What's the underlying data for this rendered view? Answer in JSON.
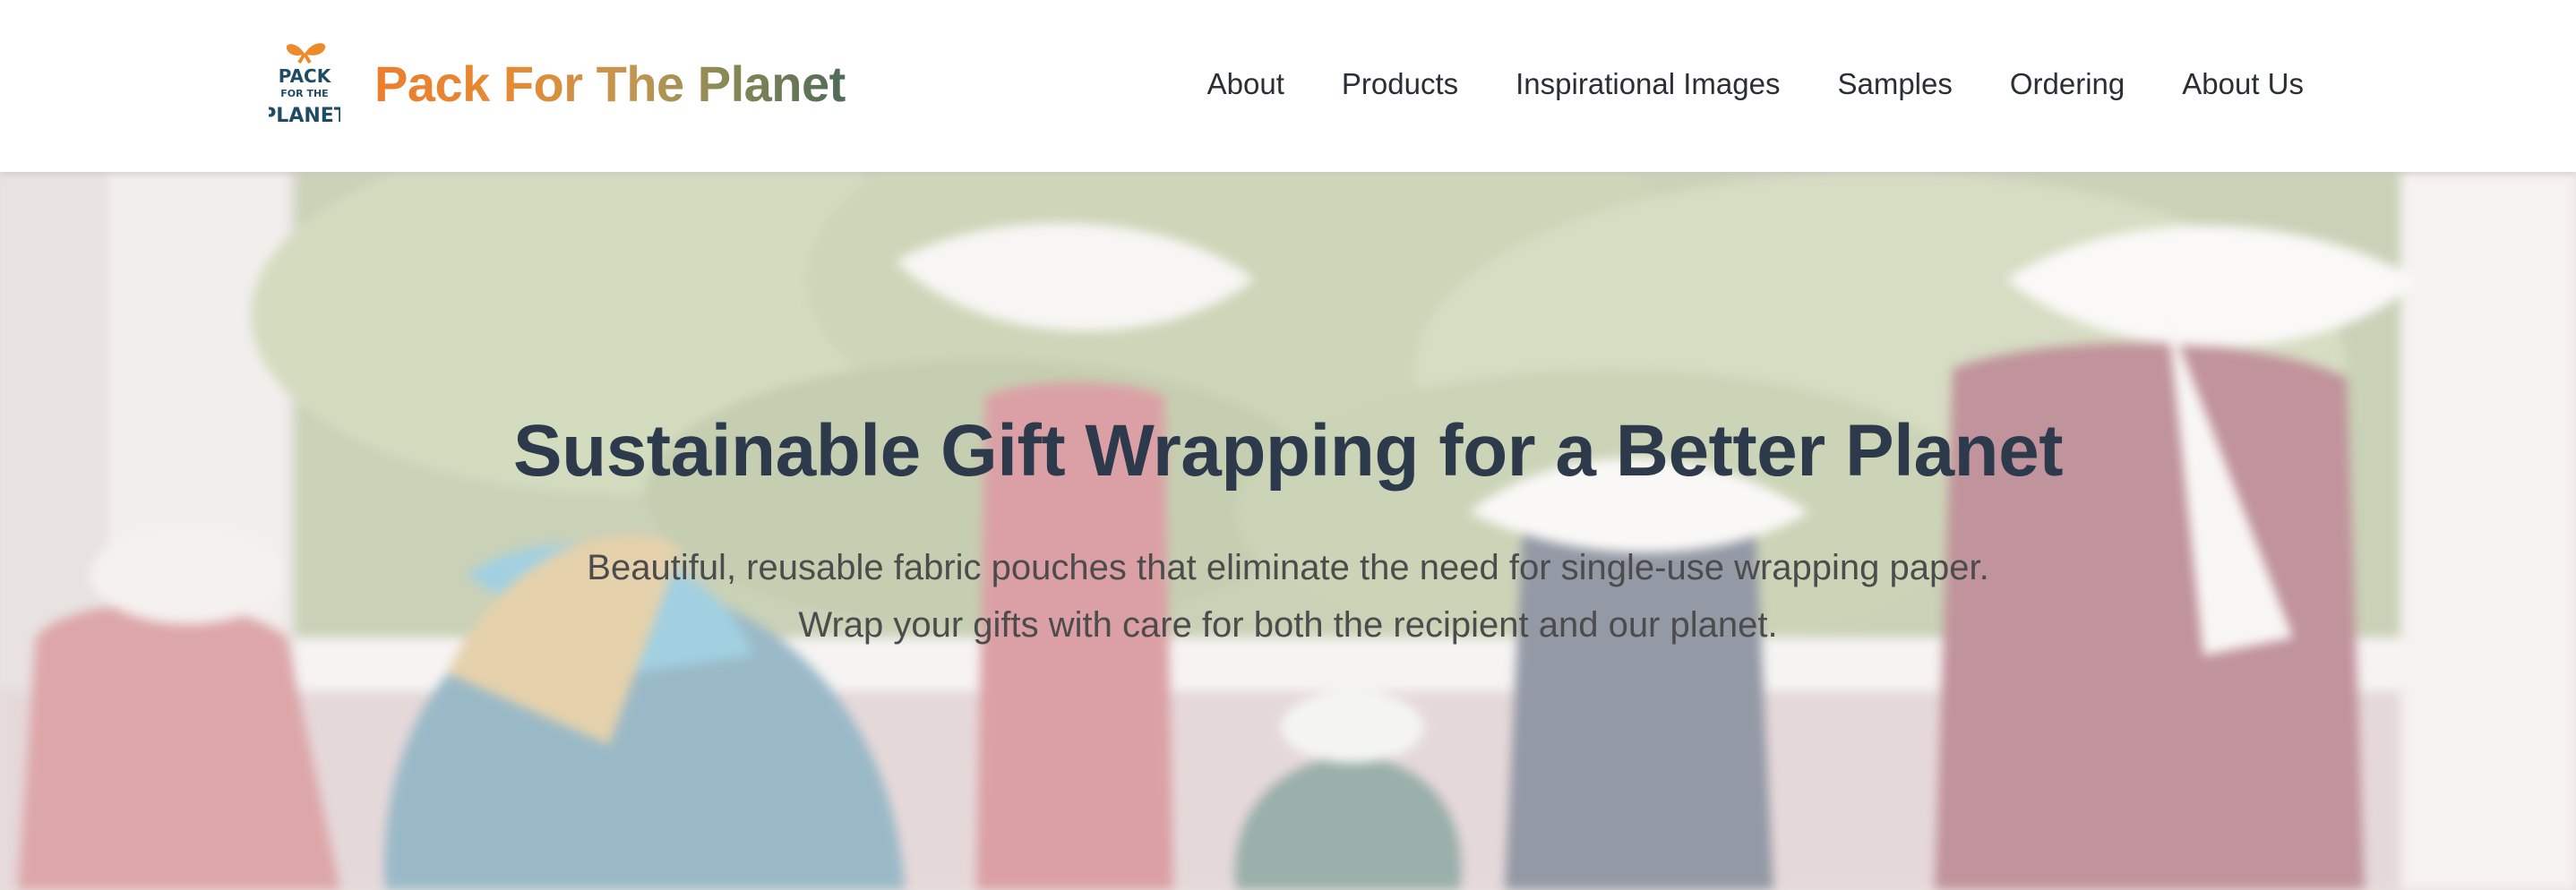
{
  "header": {
    "logo_alt": "PACK FOR THE PLANET",
    "brand": "Pack For The Planet",
    "nav": [
      {
        "label": "About"
      },
      {
        "label": "Products"
      },
      {
        "label": "Inspirational Images"
      },
      {
        "label": "Samples"
      },
      {
        "label": "Ordering"
      },
      {
        "label": "About Us"
      }
    ]
  },
  "hero": {
    "title": "Sustainable Gift Wrapping for a Better Planet",
    "subtitle_line1": "Beautiful, reusable fabric pouches that eliminate the need for single-use wrapping paper.",
    "subtitle_line2": "Wrap your gifts with care for both the recipient and our planet.",
    "background_image": "fabric-gift-pouches-on-windowsill"
  },
  "colors": {
    "brand_orange": "#ec7d2c",
    "brand_green": "#4e6a5a",
    "title": "#2d3a4c",
    "subtitle": "#4c4c4c",
    "nav_text": "#2a2f36"
  }
}
